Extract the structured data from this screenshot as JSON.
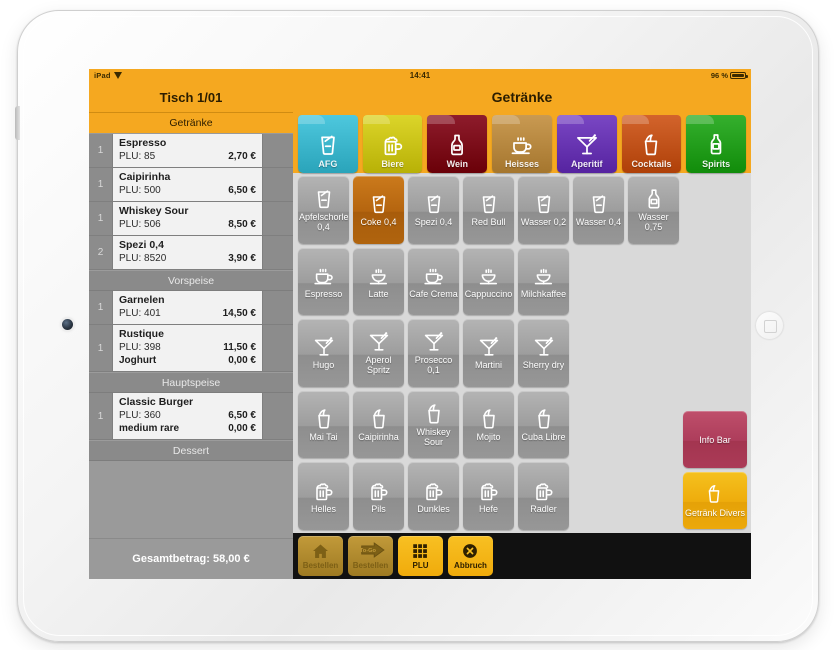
{
  "device": {
    "name": "iPad",
    "home_button": "home-button",
    "camera": "front-camera"
  },
  "statusbar": {
    "carrier": "iPad",
    "wifi_icon": "wifi-icon",
    "time": "14:41",
    "battery_percent": "96 %",
    "battery_icon": "battery-icon",
    "battery_level": 96
  },
  "order": {
    "table_title": "Tisch 1/01",
    "subheader": "Getränke",
    "total_label": "Gesamtbetrag: 58,00 €",
    "sections": [
      {
        "title": "",
        "rows": [
          {
            "qty": "1",
            "name": "Espresso",
            "plu": "PLU: 85",
            "price": "2,70 €",
            "sub": null,
            "sub_price": null
          },
          {
            "qty": "1",
            "name": "Caipirinha",
            "plu": "PLU: 500",
            "price": "6,50 €",
            "sub": null,
            "sub_price": null
          },
          {
            "qty": "1",
            "name": "Whiskey Sour",
            "plu": "PLU: 506",
            "price": "8,50 €",
            "sub": null,
            "sub_price": null
          },
          {
            "qty": "2",
            "name": "Spezi 0,4",
            "plu": "PLU: 8520",
            "price": "3,90 €",
            "sub": null,
            "sub_price": null
          }
        ]
      },
      {
        "title": "Vorspeise",
        "rows": [
          {
            "qty": "1",
            "name": "Garnelen",
            "plu": "PLU: 401",
            "price": "14,50 €",
            "sub": null,
            "sub_price": null
          },
          {
            "qty": "1",
            "name": "Rustique",
            "plu": "PLU: 398",
            "price": "11,50 €",
            "sub": "Joghurt",
            "sub_price": "0,00 €"
          }
        ]
      },
      {
        "title": "Hauptspeise",
        "rows": [
          {
            "qty": "1",
            "name": "Classic Burger",
            "plu": "PLU: 360",
            "price": "6,50 €",
            "sub": "medium rare",
            "sub_price": "0,00 €"
          }
        ]
      },
      {
        "title": "Dessert",
        "rows": []
      }
    ]
  },
  "right": {
    "title": "Getränke",
    "categories": [
      {
        "label": "AFG",
        "icon": "glass-straw-icon",
        "color": "#4ec8de"
      },
      {
        "label": "Biere",
        "icon": "beer-mug-icon",
        "color": "#dcd52a"
      },
      {
        "label": "Wein",
        "icon": "wine-bottle-icon",
        "color": "#8e1c2c"
      },
      {
        "label": "Heisses",
        "icon": "coffee-cup-icon",
        "color": "#c99a52"
      },
      {
        "label": "Aperitif",
        "icon": "cocktail-icon",
        "color": "#7a47c4"
      },
      {
        "label": "Cocktails",
        "icon": "tumbler-icon",
        "color": "#d3642c"
      },
      {
        "label": "Spirits",
        "icon": "spirits-bottle-icon",
        "color": "#35b02e"
      }
    ],
    "grid": [
      [
        {
          "label": "Apfelschorle 0,4",
          "icon": "glass-straw-icon",
          "selected": false
        },
        {
          "label": "Coke 0,4",
          "icon": "glass-straw-icon",
          "selected": true
        },
        {
          "label": "Spezi 0,4",
          "icon": "glass-straw-icon",
          "selected": false
        },
        {
          "label": "Red Bull",
          "icon": "glass-straw-icon",
          "selected": false
        },
        {
          "label": "Wasser 0,2",
          "icon": "glass-straw-icon",
          "selected": false
        },
        {
          "label": "Wasser 0,4",
          "icon": "glass-straw-icon",
          "selected": false
        },
        {
          "label": "Wasser 0,75",
          "icon": "wine-bottle-icon",
          "selected": false
        }
      ],
      [
        {
          "label": "Espresso",
          "icon": "coffee-cup-icon",
          "selected": false
        },
        {
          "label": "Latte",
          "icon": "latte-glass-icon",
          "selected": false
        },
        {
          "label": "Cafe Crema",
          "icon": "coffee-cup-icon",
          "selected": false
        },
        {
          "label": "Cappuccino",
          "icon": "latte-glass-icon",
          "selected": false
        },
        {
          "label": "Milchkaffee",
          "icon": "latte-glass-icon",
          "selected": false
        },
        {
          "label": "",
          "icon": "empty",
          "selected": false
        },
        {
          "label": "",
          "icon": "empty",
          "selected": false
        }
      ],
      [
        {
          "label": "Hugo",
          "icon": "cocktail-icon",
          "selected": false
        },
        {
          "label": "Aperol Spritz",
          "icon": "cocktail-icon",
          "selected": false
        },
        {
          "label": "Prosecco 0,1",
          "icon": "cocktail-icon",
          "selected": false
        },
        {
          "label": "Martini",
          "icon": "cocktail-icon",
          "selected": false
        },
        {
          "label": "Sherry dry",
          "icon": "cocktail-icon",
          "selected": false
        },
        {
          "label": "",
          "icon": "empty",
          "selected": false
        },
        {
          "label": "",
          "icon": "empty",
          "selected": false
        }
      ],
      [
        {
          "label": "Mai Tai",
          "icon": "tumbler-icon",
          "selected": false
        },
        {
          "label": "Caipirinha",
          "icon": "tumbler-icon",
          "selected": false
        },
        {
          "label": "Whiskey Sour",
          "icon": "tumbler-icon",
          "selected": false
        },
        {
          "label": "Mojito",
          "icon": "tumbler-icon",
          "selected": false
        },
        {
          "label": "Cuba Libre",
          "icon": "tumbler-icon",
          "selected": false
        },
        {
          "label": "",
          "icon": "empty",
          "selected": false
        },
        {
          "label": "",
          "icon": "empty",
          "selected": false
        }
      ],
      [
        {
          "label": "Helles",
          "icon": "beer-mug-icon",
          "selected": false
        },
        {
          "label": "Pils",
          "icon": "beer-mug-icon",
          "selected": false
        },
        {
          "label": "Dunkles",
          "icon": "beer-mug-icon",
          "selected": false
        },
        {
          "label": "Hefe",
          "icon": "beer-mug-icon",
          "selected": false
        },
        {
          "label": "Radler",
          "icon": "beer-mug-icon",
          "selected": false
        },
        {
          "label": "",
          "icon": "empty",
          "selected": false
        },
        {
          "label": "",
          "icon": "empty",
          "selected": false
        }
      ]
    ],
    "side_buttons": [
      {
        "label": "Info Bar",
        "icon": "none",
        "color": "#ad3d5b"
      },
      {
        "label": "Getränk Divers",
        "icon": "tumbler-icon",
        "color": "#eeac0c"
      }
    ]
  },
  "toolbar": [
    {
      "label": "Bestellen",
      "icon": "home-icon",
      "enabled": false
    },
    {
      "label": "Bestellen",
      "icon": "to-go-arrow-icon",
      "enabled": false,
      "badge": "To-Go"
    },
    {
      "label": "PLU",
      "icon": "keypad-icon",
      "enabled": true
    },
    {
      "label": "Abbruch",
      "icon": "cancel-x-icon",
      "enabled": true
    }
  ]
}
